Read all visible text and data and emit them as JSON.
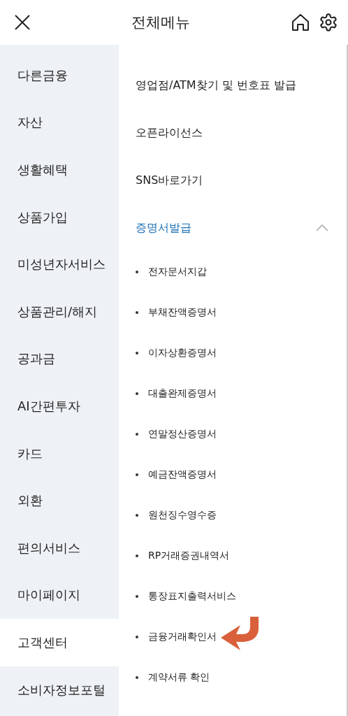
{
  "header": {
    "title": "전체메뉴"
  },
  "sidebar": {
    "items": [
      {
        "label": "다른금융",
        "selected": false
      },
      {
        "label": "자산",
        "selected": false
      },
      {
        "label": "생활혜택",
        "selected": false
      },
      {
        "label": "상품가입",
        "selected": false
      },
      {
        "label": "미성년자서비스",
        "selected": false
      },
      {
        "label": "상품관리/해지",
        "selected": false
      },
      {
        "label": "공과금",
        "selected": false
      },
      {
        "label": "AI간편투자",
        "selected": false
      },
      {
        "label": "카드",
        "selected": false
      },
      {
        "label": "외환",
        "selected": false
      },
      {
        "label": "편의서비스",
        "selected": false
      },
      {
        "label": "마이페이지",
        "selected": false
      },
      {
        "label": "고객센터",
        "selected": true
      },
      {
        "label": "소비자정보포털",
        "selected": false
      }
    ]
  },
  "menu": [
    {
      "label": "영업점/ATM찾기 및 번호표 발급"
    },
    {
      "label": "오픈라이선스"
    },
    {
      "label": "SNS바로가기"
    },
    {
      "label": "증명서발급",
      "expanded": true,
      "children": [
        {
          "label": "전자문서지갑",
          "pointer": false
        },
        {
          "label": "부채잔액증명서",
          "pointer": false
        },
        {
          "label": "이자상환증명서",
          "pointer": false
        },
        {
          "label": "대출완제증명서",
          "pointer": false
        },
        {
          "label": "연말정산증명서",
          "pointer": false
        },
        {
          "label": "예금잔액증명서",
          "pointer": false
        },
        {
          "label": "원천징수영수증",
          "pointer": false
        },
        {
          "label": "RP거래증권내역서",
          "pointer": false
        },
        {
          "label": "통장표지출력서비스",
          "pointer": false
        },
        {
          "label": "금융거래확인서",
          "pointer": true
        },
        {
          "label": "계약서류 확인",
          "pointer": false
        }
      ]
    }
  ]
}
